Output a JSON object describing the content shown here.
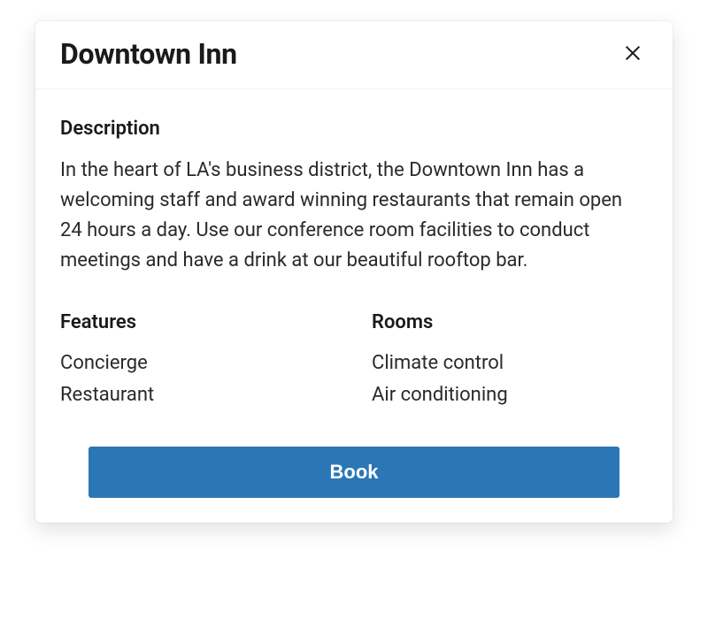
{
  "dialog": {
    "title": "Downtown Inn"
  },
  "sections": {
    "description_label": "Description",
    "description_text": "In the heart of LA's business district, the Downtown Inn has a welcoming staff and award winning restaurants that remain open 24 hours a day. Use our conference room facilities to conduct meetings and have a drink at our beautiful rooftop bar.",
    "features_label": "Features",
    "features": [
      "Concierge",
      "Restaurant"
    ],
    "rooms_label": "Rooms",
    "rooms": [
      "Climate control",
      "Air conditioning"
    ]
  },
  "footer": {
    "book_label": "Book"
  }
}
